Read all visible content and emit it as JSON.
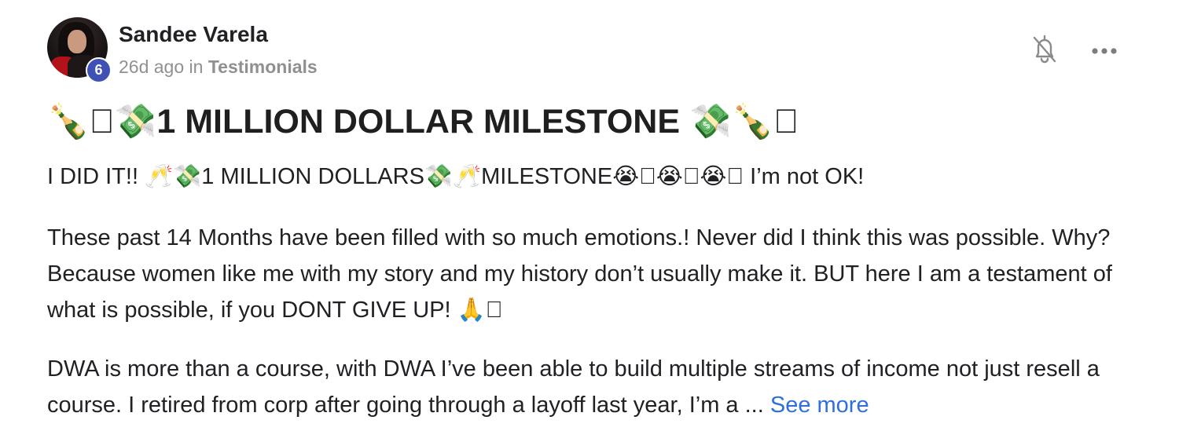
{
  "author": {
    "name": "Sandee Varela",
    "level": "6",
    "time_ago": "26d ago",
    "in_word": "in",
    "category": "Testimonials"
  },
  "actions": {
    "bell_icon": "bell-off-icon",
    "more_icon": "more-horizontal-icon"
  },
  "post": {
    "title": "🍾􀀀💸1 MILLION DOLLAR MILESTONE 💸🍾􀀀",
    "paragraph_1": "I DID IT!! 🥂💸1 MILLION DOLLARS💸🥂MILESTONE😭􀀀😭􀀀😭􀀀 I’m not OK!",
    "paragraph_2": "These past 14 Months have been filled with so much emotions.! Never did I think this was possible. Why? Because women like me with my story and my history don’t usually make it. BUT here I am a testament of what is possible, if you DONT GIVE UP! 🙏􀀀",
    "paragraph_3": "DWA is more than a course, with DWA I’ve been able to build multiple streams of income not just resell a course. I retired from corp after going through a layoff last year, I’m a ...",
    "see_more": "See more"
  },
  "colors": {
    "badge": "#3f51b5",
    "link": "#2f6fdd",
    "meta": "#909090"
  }
}
